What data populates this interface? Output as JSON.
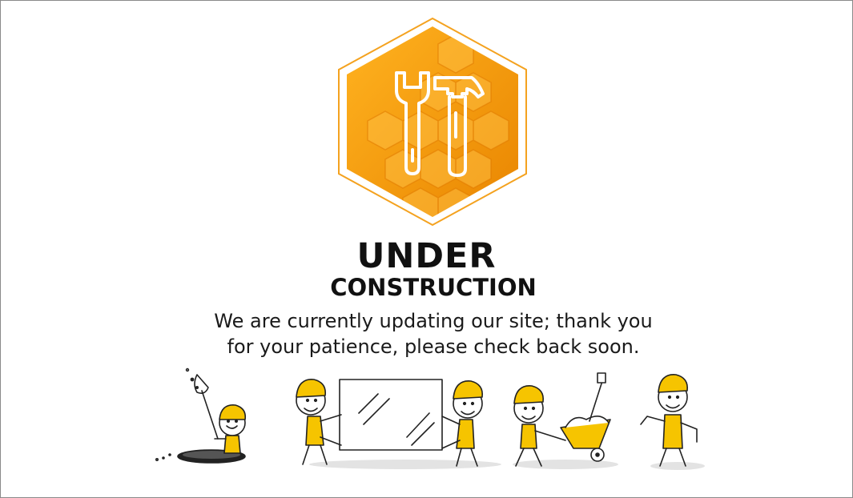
{
  "heading": {
    "main": "UNDER",
    "sub": "CONSTRUCTION"
  },
  "message": {
    "line1": "We are currently updating our site; thank you",
    "line2": "for your patience, please check back soon."
  },
  "emblem": {
    "icons": [
      "wrench-icon",
      "hammer-icon"
    ],
    "colors": {
      "hex_dark": "#e98a00",
      "hex_mid": "#f7a823",
      "hex_light": "#ffc24a",
      "outline": "#f4a21f"
    }
  },
  "illustration": {
    "figures": [
      "digging-worker",
      "glass-carrying-workers",
      "wheelbarrow-worker",
      "thumbs-up-worker"
    ],
    "colors": {
      "helmet": "#f6c400",
      "ink": "#222222",
      "shadow": "#d8d8d8"
    }
  }
}
